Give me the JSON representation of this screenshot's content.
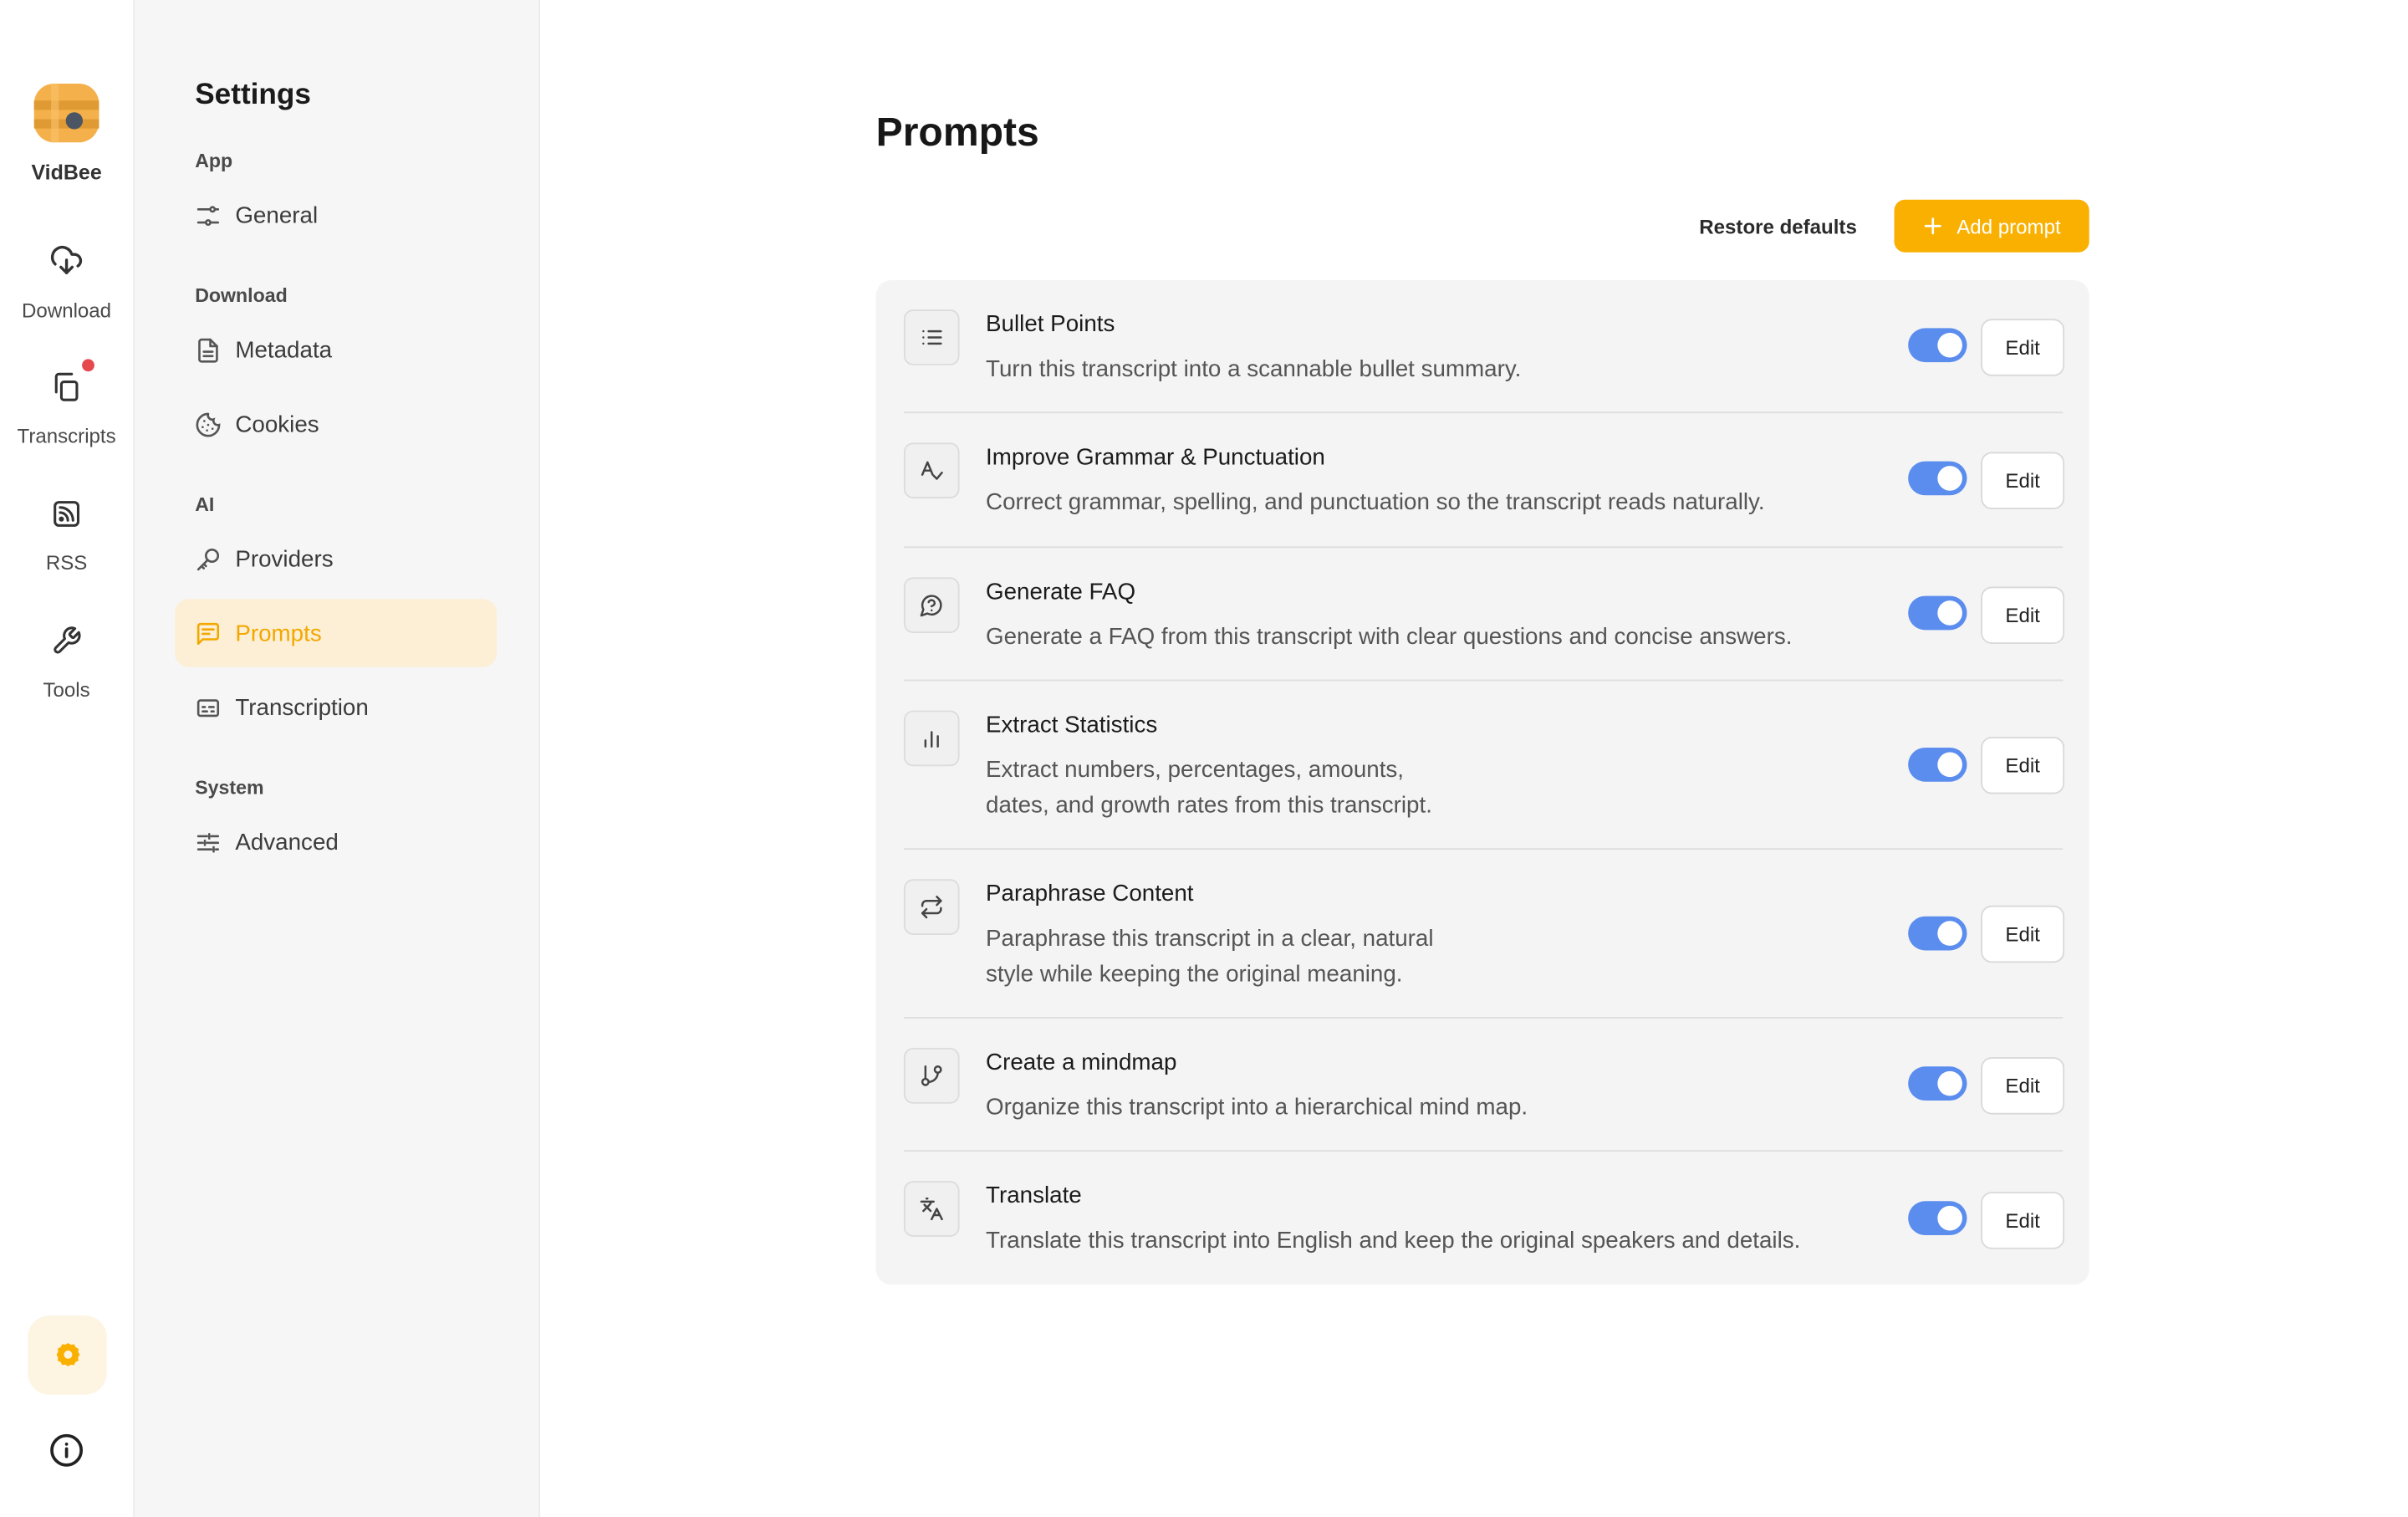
{
  "app": {
    "brand": "VidBee"
  },
  "rail": {
    "items": [
      {
        "label": "Download",
        "icon": "cloud-download-icon"
      },
      {
        "label": "Transcripts",
        "icon": "files-icon",
        "has_badge": true
      },
      {
        "label": "RSS",
        "icon": "rss-icon"
      },
      {
        "label": "Tools",
        "icon": "wrench-icon"
      }
    ],
    "settings_icon": "gear-icon",
    "info_icon": "info-icon"
  },
  "settings_nav": {
    "title": "Settings",
    "sections": [
      {
        "label": "App",
        "items": [
          {
            "label": "General",
            "icon": "sliders-icon"
          }
        ]
      },
      {
        "label": "Download",
        "items": [
          {
            "label": "Metadata",
            "icon": "file-icon"
          },
          {
            "label": "Cookies",
            "icon": "cookie-icon"
          }
        ]
      },
      {
        "label": "AI",
        "items": [
          {
            "label": "Providers",
            "icon": "key-icon"
          },
          {
            "label": "Prompts",
            "icon": "message-icon",
            "active": true
          },
          {
            "label": "Transcription",
            "icon": "captions-icon"
          }
        ]
      },
      {
        "label": "System",
        "items": [
          {
            "label": "Advanced",
            "icon": "settings-sliders-icon"
          }
        ]
      }
    ]
  },
  "main": {
    "title": "Prompts",
    "restore_label": "Restore defaults",
    "add_label": "Add prompt",
    "edit_label": "Edit",
    "prompts": [
      {
        "title": "Bullet Points",
        "description": "Turn this transcript into a scannable bullet summary.",
        "enabled": true,
        "icon": "list-icon"
      },
      {
        "title": "Improve Grammar & Punctuation",
        "description": "Correct grammar, spelling, and punctuation so the transcript reads naturally.",
        "enabled": true,
        "icon": "spell-check-icon"
      },
      {
        "title": "Generate FAQ",
        "description": "Generate a FAQ from this transcript with clear questions and concise answers.",
        "enabled": true,
        "icon": "help-bubble-icon"
      },
      {
        "title": "Extract Statistics",
        "description": "Extract numbers, percentages, amounts,\ndates, and growth rates from this transcript.",
        "enabled": true,
        "icon": "bar-chart-icon"
      },
      {
        "title": "Paraphrase Content",
        "description": "Paraphrase this transcript in a clear, natural\nstyle while keeping the original meaning.",
        "enabled": true,
        "icon": "repeat-icon"
      },
      {
        "title": "Create a mindmap",
        "description": "Organize this transcript into a hierarchical mind map.",
        "enabled": true,
        "icon": "git-branch-icon"
      },
      {
        "title": "Translate",
        "description": "Translate this transcript into English and keep the original speakers and details.",
        "enabled": true,
        "icon": "languages-icon"
      }
    ]
  },
  "colors": {
    "accent": "#f9b000",
    "toggle_on": "#5b8def",
    "active_nav_bg": "#fcefd6"
  }
}
